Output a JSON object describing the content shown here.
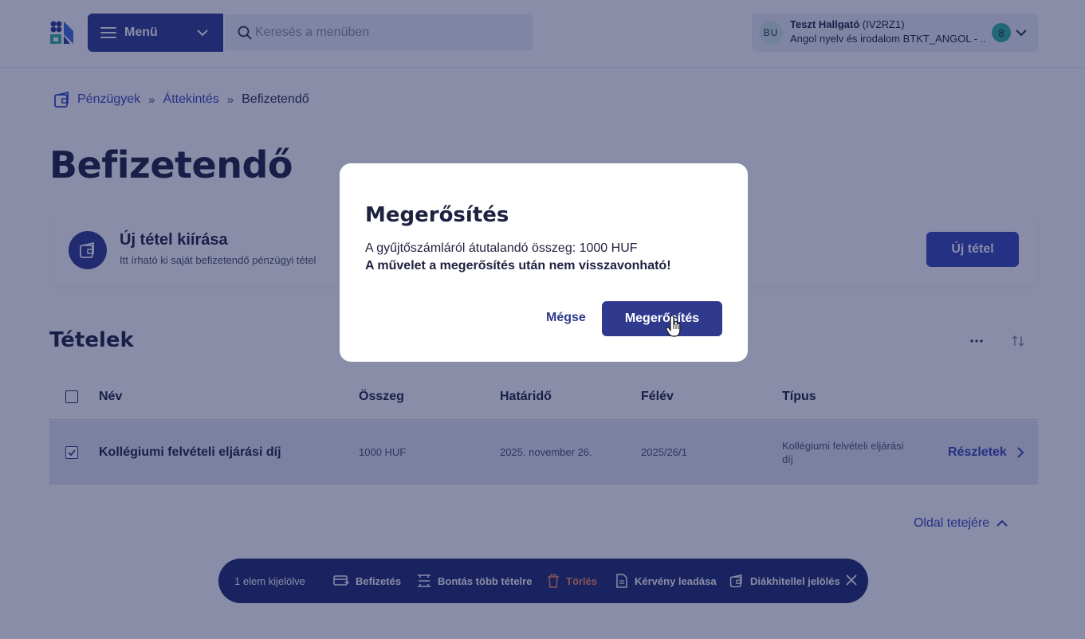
{
  "header": {
    "menu_label": "Menü",
    "search_placeholder": "Keresés a menüben",
    "user": {
      "initials": "BU",
      "name": "Teszt Hallgató",
      "code": "(IV2RZ1)",
      "program": "Angol nyelv és irodalom BTKT_ANGOL - ...",
      "badge": "8"
    }
  },
  "breadcrumb": {
    "items": [
      "Pénzügyek",
      "Áttekintés"
    ],
    "current": "Befizetendő",
    "separator": "»"
  },
  "page_title": "Befizetendő",
  "new_item_card": {
    "title": "Új tétel kiírása",
    "subtitle": "Itt írható ki saját befizetendő pénzügyi tétel",
    "button_label": "Új tétel"
  },
  "items_section": {
    "title": "Tételek",
    "more_label": "...",
    "columns": [
      "Név",
      "Összeg",
      "Határidő",
      "Félév",
      "Típus"
    ],
    "rows": [
      {
        "name": "Kollégiumi felvételi eljárási díj",
        "amount": "1000 HUF",
        "deadline": "2025. november 26.",
        "semester": "2025/26/1",
        "type": "Kollégiumi felvételi eljárási díj",
        "details_label": "Részletek",
        "checked": true
      }
    ]
  },
  "back_to_top": "Oldal tetejére",
  "action_bar": {
    "selected_count": "1 elem kijelölve",
    "actions": [
      "Befizetés",
      "Bontás több tételre",
      "Törlés",
      "Kérvény leadása",
      "Diákhitellel jelölés"
    ]
  },
  "modal": {
    "title": "Megerősítés",
    "text": "A gyűjtőszámláról átutalandó összeg: 1000 HUF",
    "warning": "A művelet a megerősítés után nem visszavonható!",
    "cancel_label": "Mégse",
    "confirm_label": "Megerősítés"
  },
  "colors": {
    "primary": "#2f3a8f",
    "link": "#3546b8",
    "danger": "#ff8a65",
    "badge": "#2fb39a"
  }
}
